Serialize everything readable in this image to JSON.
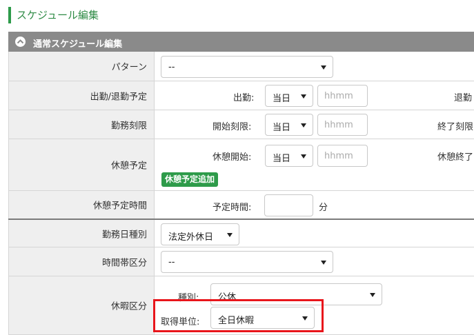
{
  "page": {
    "title": "スケジュール編集"
  },
  "section": {
    "title": "通常スケジュール編集"
  },
  "rows": {
    "pattern": {
      "label": "パターン",
      "value": "--"
    },
    "attendance": {
      "label": "出勤/退勤予定",
      "start_label": "出勤:",
      "start_day": "当日",
      "start_placeholder": "hhmm",
      "end_label": "退勤"
    },
    "work_limit": {
      "label": "勤務刻限",
      "start_label": "開始刻限:",
      "start_day": "当日",
      "start_placeholder": "hhmm",
      "end_label": "終了刻限"
    },
    "break": {
      "label": "休憩予定",
      "start_label": "休憩開始:",
      "start_day": "当日",
      "start_placeholder": "hhmm",
      "end_label": "休憩終了",
      "add_button": "休憩予定追加"
    },
    "break_time": {
      "label": "休憩予定時間",
      "field_label": "予定時間:",
      "unit": "分"
    },
    "day_type": {
      "label": "勤務日種別",
      "value": "法定外休日"
    },
    "time_zone": {
      "label": "時間帯区分",
      "value": "--"
    },
    "leave": {
      "label": "休暇区分",
      "type_label": "種別:",
      "type_value": "公休",
      "unit_label": "取得単位:",
      "unit_value": "全日休暇"
    }
  },
  "colors": {
    "accent": "#2e9b4a",
    "header_bg": "#8a8a8a",
    "highlight": "#e8151b"
  }
}
